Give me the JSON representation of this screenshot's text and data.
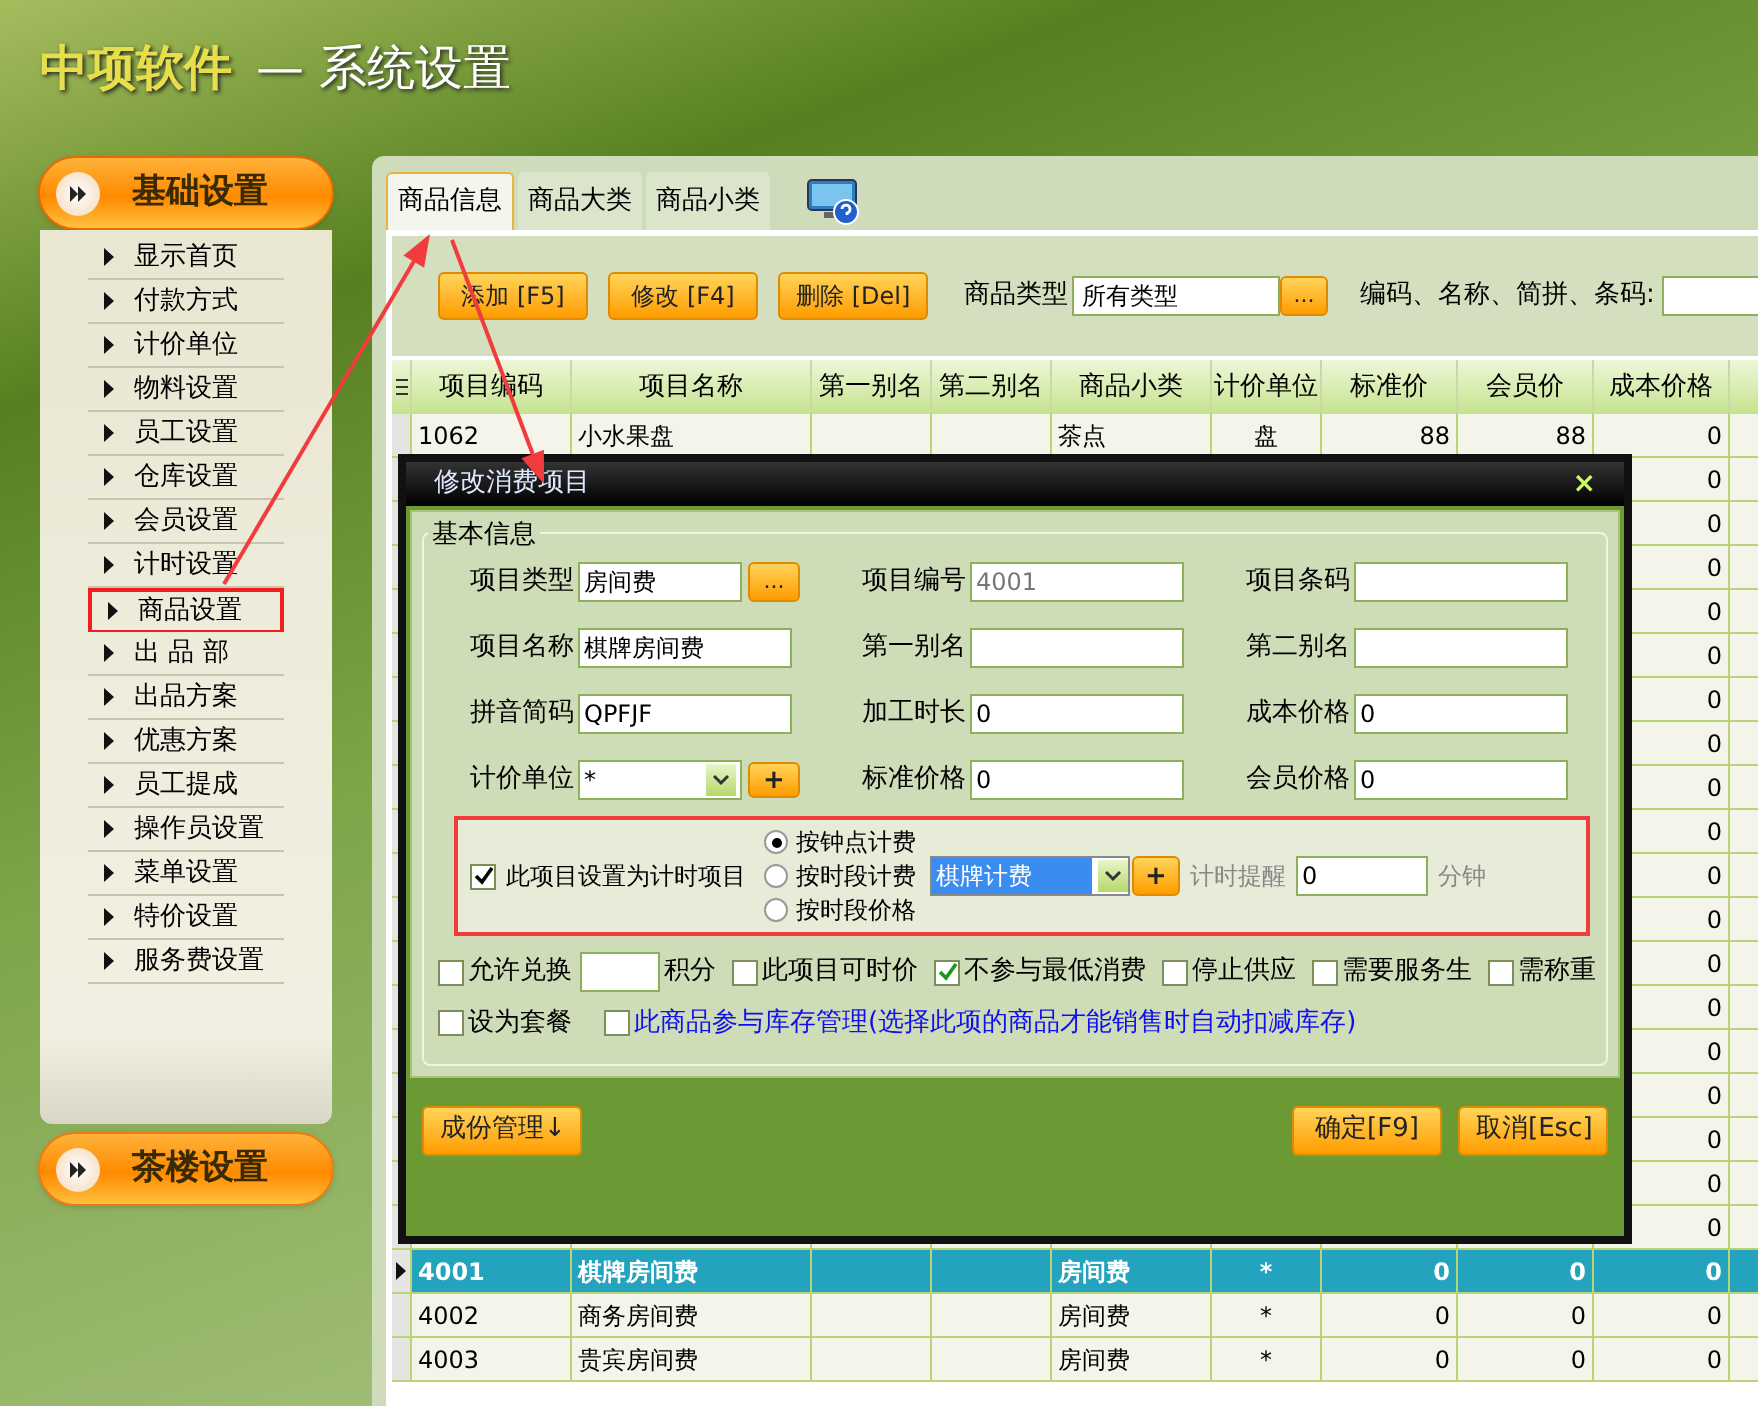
{
  "header": {
    "brand": "中项软件",
    "title": "— 系统设置"
  },
  "sidebar": {
    "sections": [
      {
        "title": "基础设置",
        "expanded": true,
        "items": [
          {
            "label": "显示首页",
            "highlighted": false
          },
          {
            "label": "付款方式",
            "highlighted": false
          },
          {
            "label": "计价单位",
            "highlighted": false
          },
          {
            "label": "物料设置",
            "highlighted": false
          },
          {
            "label": "员工设置",
            "highlighted": false
          },
          {
            "label": "仓库设置",
            "highlighted": false
          },
          {
            "label": "会员设置",
            "highlighted": false
          },
          {
            "label": "计时设置",
            "highlighted": false
          },
          {
            "label": "商品设置",
            "highlighted": true
          },
          {
            "label": "出 品 部",
            "highlighted": false
          },
          {
            "label": "出品方案",
            "highlighted": false
          },
          {
            "label": "优惠方案",
            "highlighted": false
          },
          {
            "label": "员工提成",
            "highlighted": false
          },
          {
            "label": "操作员设置",
            "highlighted": false
          },
          {
            "label": "菜单设置",
            "highlighted": false
          },
          {
            "label": "特价设置",
            "highlighted": false
          },
          {
            "label": "服务费设置",
            "highlighted": false
          }
        ]
      },
      {
        "title": "茶楼设置",
        "expanded": false
      }
    ]
  },
  "tabs": [
    {
      "label": "商品信息",
      "selected": true
    },
    {
      "label": "商品大类",
      "selected": false
    },
    {
      "label": "商品小类",
      "selected": false
    }
  ],
  "toolbar": {
    "buttons": [
      "添加 [F5]",
      "修改 [F4]",
      "删除 [Del]"
    ],
    "type_label": "商品类型",
    "type_value": "所有类型",
    "type_button": "...",
    "search_label": "编码、名称、简拼、条码:"
  },
  "table": {
    "columns": [
      "项目编码",
      "项目名称",
      "第一别名",
      "第二别名",
      "商品小类",
      "计价单位",
      "标准价",
      "会员价",
      "成本价格"
    ],
    "rows": [
      {
        "selected": false,
        "cells": [
          "1062",
          "小水果盘",
          "",
          "",
          "茶点",
          "盘",
          "88",
          "88",
          "0"
        ]
      },
      {
        "selected": false,
        "cells": [
          "",
          "",
          "",
          "",
          "",
          "",
          "",
          "",
          "0"
        ]
      },
      {
        "selected": false,
        "cells": [
          "",
          "",
          "",
          "",
          "",
          "",
          "",
          "",
          "0"
        ]
      },
      {
        "selected": false,
        "cells": [
          "",
          "",
          "",
          "",
          "",
          "",
          "",
          "",
          "0"
        ]
      },
      {
        "selected": false,
        "cells": [
          "",
          "",
          "",
          "",
          "",
          "",
          "",
          "",
          "0"
        ]
      },
      {
        "selected": false,
        "cells": [
          "",
          "",
          "",
          "",
          "",
          "",
          "",
          "",
          "0"
        ]
      },
      {
        "selected": false,
        "cells": [
          "",
          "",
          "",
          "",
          "",
          "",
          "",
          "",
          "0"
        ]
      },
      {
        "selected": false,
        "cells": [
          "",
          "",
          "",
          "",
          "",
          "",
          "",
          "",
          "0"
        ]
      },
      {
        "selected": false,
        "cells": [
          "",
          "",
          "",
          "",
          "",
          "",
          "",
          "",
          "0"
        ]
      },
      {
        "selected": false,
        "cells": [
          "",
          "",
          "",
          "",
          "",
          "",
          "",
          "",
          "0"
        ]
      },
      {
        "selected": false,
        "cells": [
          "",
          "",
          "",
          "",
          "",
          "",
          "",
          "",
          "0"
        ]
      },
      {
        "selected": false,
        "cells": [
          "",
          "",
          "",
          "",
          "",
          "",
          "",
          "",
          "0"
        ]
      },
      {
        "selected": false,
        "cells": [
          "",
          "",
          "",
          "",
          "",
          "",
          "",
          "",
          "0"
        ]
      },
      {
        "selected": false,
        "cells": [
          "",
          "",
          "",
          "",
          "",
          "",
          "",
          "",
          "0"
        ]
      },
      {
        "selected": false,
        "cells": [
          "",
          "",
          "",
          "",
          "",
          "",
          "",
          "",
          "0"
        ]
      },
      {
        "selected": false,
        "cells": [
          "",
          "",
          "",
          "",
          "",
          "",
          "",
          "",
          "0"
        ]
      },
      {
        "selected": false,
        "cells": [
          "",
          "",
          "",
          "",
          "",
          "",
          "",
          "",
          "0"
        ]
      },
      {
        "selected": false,
        "cells": [
          "",
          "",
          "",
          "",
          "",
          "",
          "",
          "",
          "0"
        ]
      },
      {
        "selected": false,
        "cells": [
          "",
          "",
          "",
          "",
          "",
          "",
          "",
          "",
          "0"
        ]
      },
      {
        "selected": true,
        "cells": [
          "4001",
          "棋牌房间费",
          "",
          "",
          "房间费",
          "*",
          "0",
          "0",
          "0"
        ]
      },
      {
        "selected": false,
        "cells": [
          "4002",
          "商务房间费",
          "",
          "",
          "房间费",
          "*",
          "0",
          "0",
          "0"
        ]
      },
      {
        "selected": false,
        "cells": [
          "4003",
          "贵宾房间费",
          "",
          "",
          "房间费",
          "*",
          "0",
          "0",
          "0"
        ]
      }
    ]
  },
  "dialog": {
    "title": "修改消费项目",
    "close": "×",
    "group": "基本信息",
    "fields": [
      {
        "label": "项目类型",
        "kind": "picker",
        "value": "房间费",
        "button": "..."
      },
      {
        "label": "项目编号",
        "kind": "readonly",
        "value": "4001"
      },
      {
        "label": "项目条码",
        "kind": "text"
      },
      {
        "label": "项目名称",
        "kind": "text",
        "value": "棋牌房间费"
      },
      {
        "label": "第一别名",
        "kind": "text"
      },
      {
        "label": "第二别名",
        "kind": "text"
      },
      {
        "label": "拼音简码",
        "kind": "text",
        "value": "QPFJF"
      },
      {
        "label": "加工时长",
        "kind": "text",
        "value": "0"
      },
      {
        "label": "成本价格",
        "kind": "text",
        "value": "0"
      },
      {
        "label": "计价单位",
        "kind": "select",
        "value": "*",
        "button": "+"
      },
      {
        "label": "标准价格",
        "kind": "text",
        "value": "0"
      },
      {
        "label": "会员价格",
        "kind": "text",
        "value": "0"
      }
    ],
    "timing": {
      "highlighted": true,
      "label": "此项目设置为计时项目",
      "checked": true,
      "modes": [
        {
          "label": "按钟点计费",
          "selected": true
        },
        {
          "label": "按时段计费",
          "selected": false
        },
        {
          "label": "按时段价格",
          "selected": false
        }
      ],
      "scheme": "棋牌计费",
      "add_button": "+",
      "reminder_label": "计时提醒",
      "reminder_value": "0",
      "unit": "分钟"
    },
    "options": [
      {
        "kind": "points",
        "label": "允许兑换",
        "suffix": "积分",
        "checked": false
      },
      {
        "kind": "checkbox",
        "label": "此项目可时价",
        "checked": false
      },
      {
        "kind": "checkbox",
        "label": "不参与最低消费",
        "checked": true
      },
      {
        "kind": "checkbox",
        "label": "停止供应",
        "checked": false
      },
      {
        "kind": "checkbox",
        "label": "需要服务生",
        "checked": false
      },
      {
        "kind": "checkbox",
        "label": "需称重",
        "checked": false
      },
      {
        "kind": "checkbox",
        "label": "设为套餐",
        "checked": false
      },
      {
        "kind": "note",
        "label": "此商品参与库存管理(选择此项的商品才能销售时自动扣减库存)",
        "checked": false
      }
    ],
    "buttons": [
      "成份管理↓",
      "确定[F9]",
      "取消[Esc]"
    ]
  }
}
